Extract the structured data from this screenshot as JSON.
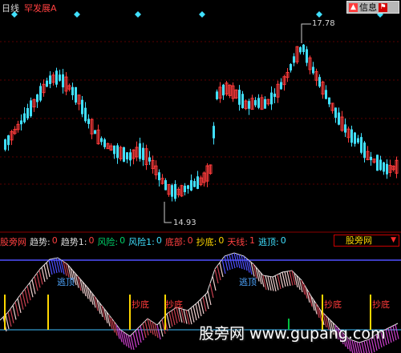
{
  "header": {
    "period_label": "日线",
    "indicator_name": "罕发展A",
    "info_button_label": "信息",
    "info_icon": "chevron-up-icon",
    "flag_icon": "flag-icon"
  },
  "price_panel": {
    "high_label": "17.78",
    "low_label": "14.93"
  },
  "indicator_bar": {
    "items": [
      {
        "name": "股旁网",
        "value": ""
      },
      {
        "name": "趋势:",
        "value": "0"
      },
      {
        "name": "趋势1:",
        "value": "0"
      },
      {
        "name": "风险:",
        "value": "0"
      },
      {
        "name": "风险1:",
        "value": "0"
      },
      {
        "name": "底部:",
        "value": "0"
      },
      {
        "name": "抄底:",
        "value": "0"
      },
      {
        "name": "天线:",
        "value": "1"
      },
      {
        "name": "逃顶:",
        "value": "0"
      }
    ],
    "select_value": "股旁网"
  },
  "annotations": {
    "top_signal_1": "逃顶",
    "top_signal_2": "逃顶",
    "bottom_signals": [
      "抄底",
      "抄底",
      "抄底",
      "抄底"
    ]
  },
  "watermark": "股旁网 www.gupang.com",
  "colors": {
    "up": "#ff3b3b",
    "down": "#40e0ff",
    "hline": "#5050ff",
    "signal_text": "#ff3b3b",
    "escape_text": "#4ea6ff"
  }
}
